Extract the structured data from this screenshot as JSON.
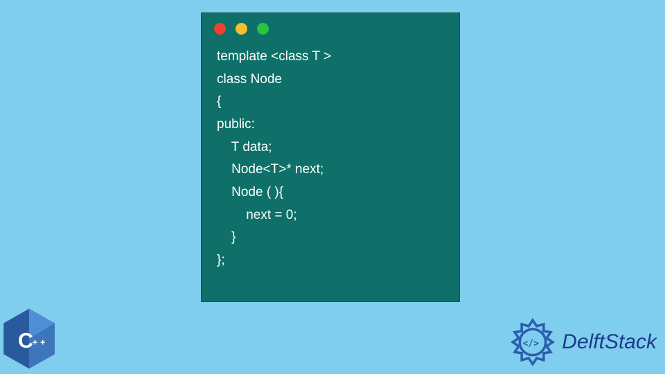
{
  "window": {
    "dots": [
      "red",
      "yellow",
      "green"
    ]
  },
  "code": {
    "lines": [
      "template <class T >",
      "class Node",
      "{",
      "public:",
      "    T data;",
      "    Node<T>* next;",
      "    Node ( ){",
      "        next = 0;",
      "    }",
      "};"
    ]
  },
  "logos": {
    "cpp_label": "C++",
    "delftstack_text": "DelftStack"
  },
  "colors": {
    "background": "#7fceee",
    "window_bg": "#0e7068",
    "code_text": "#ffffff",
    "delft_blue": "#1c3b8c",
    "cpp_blue": "#1f5fa8"
  }
}
